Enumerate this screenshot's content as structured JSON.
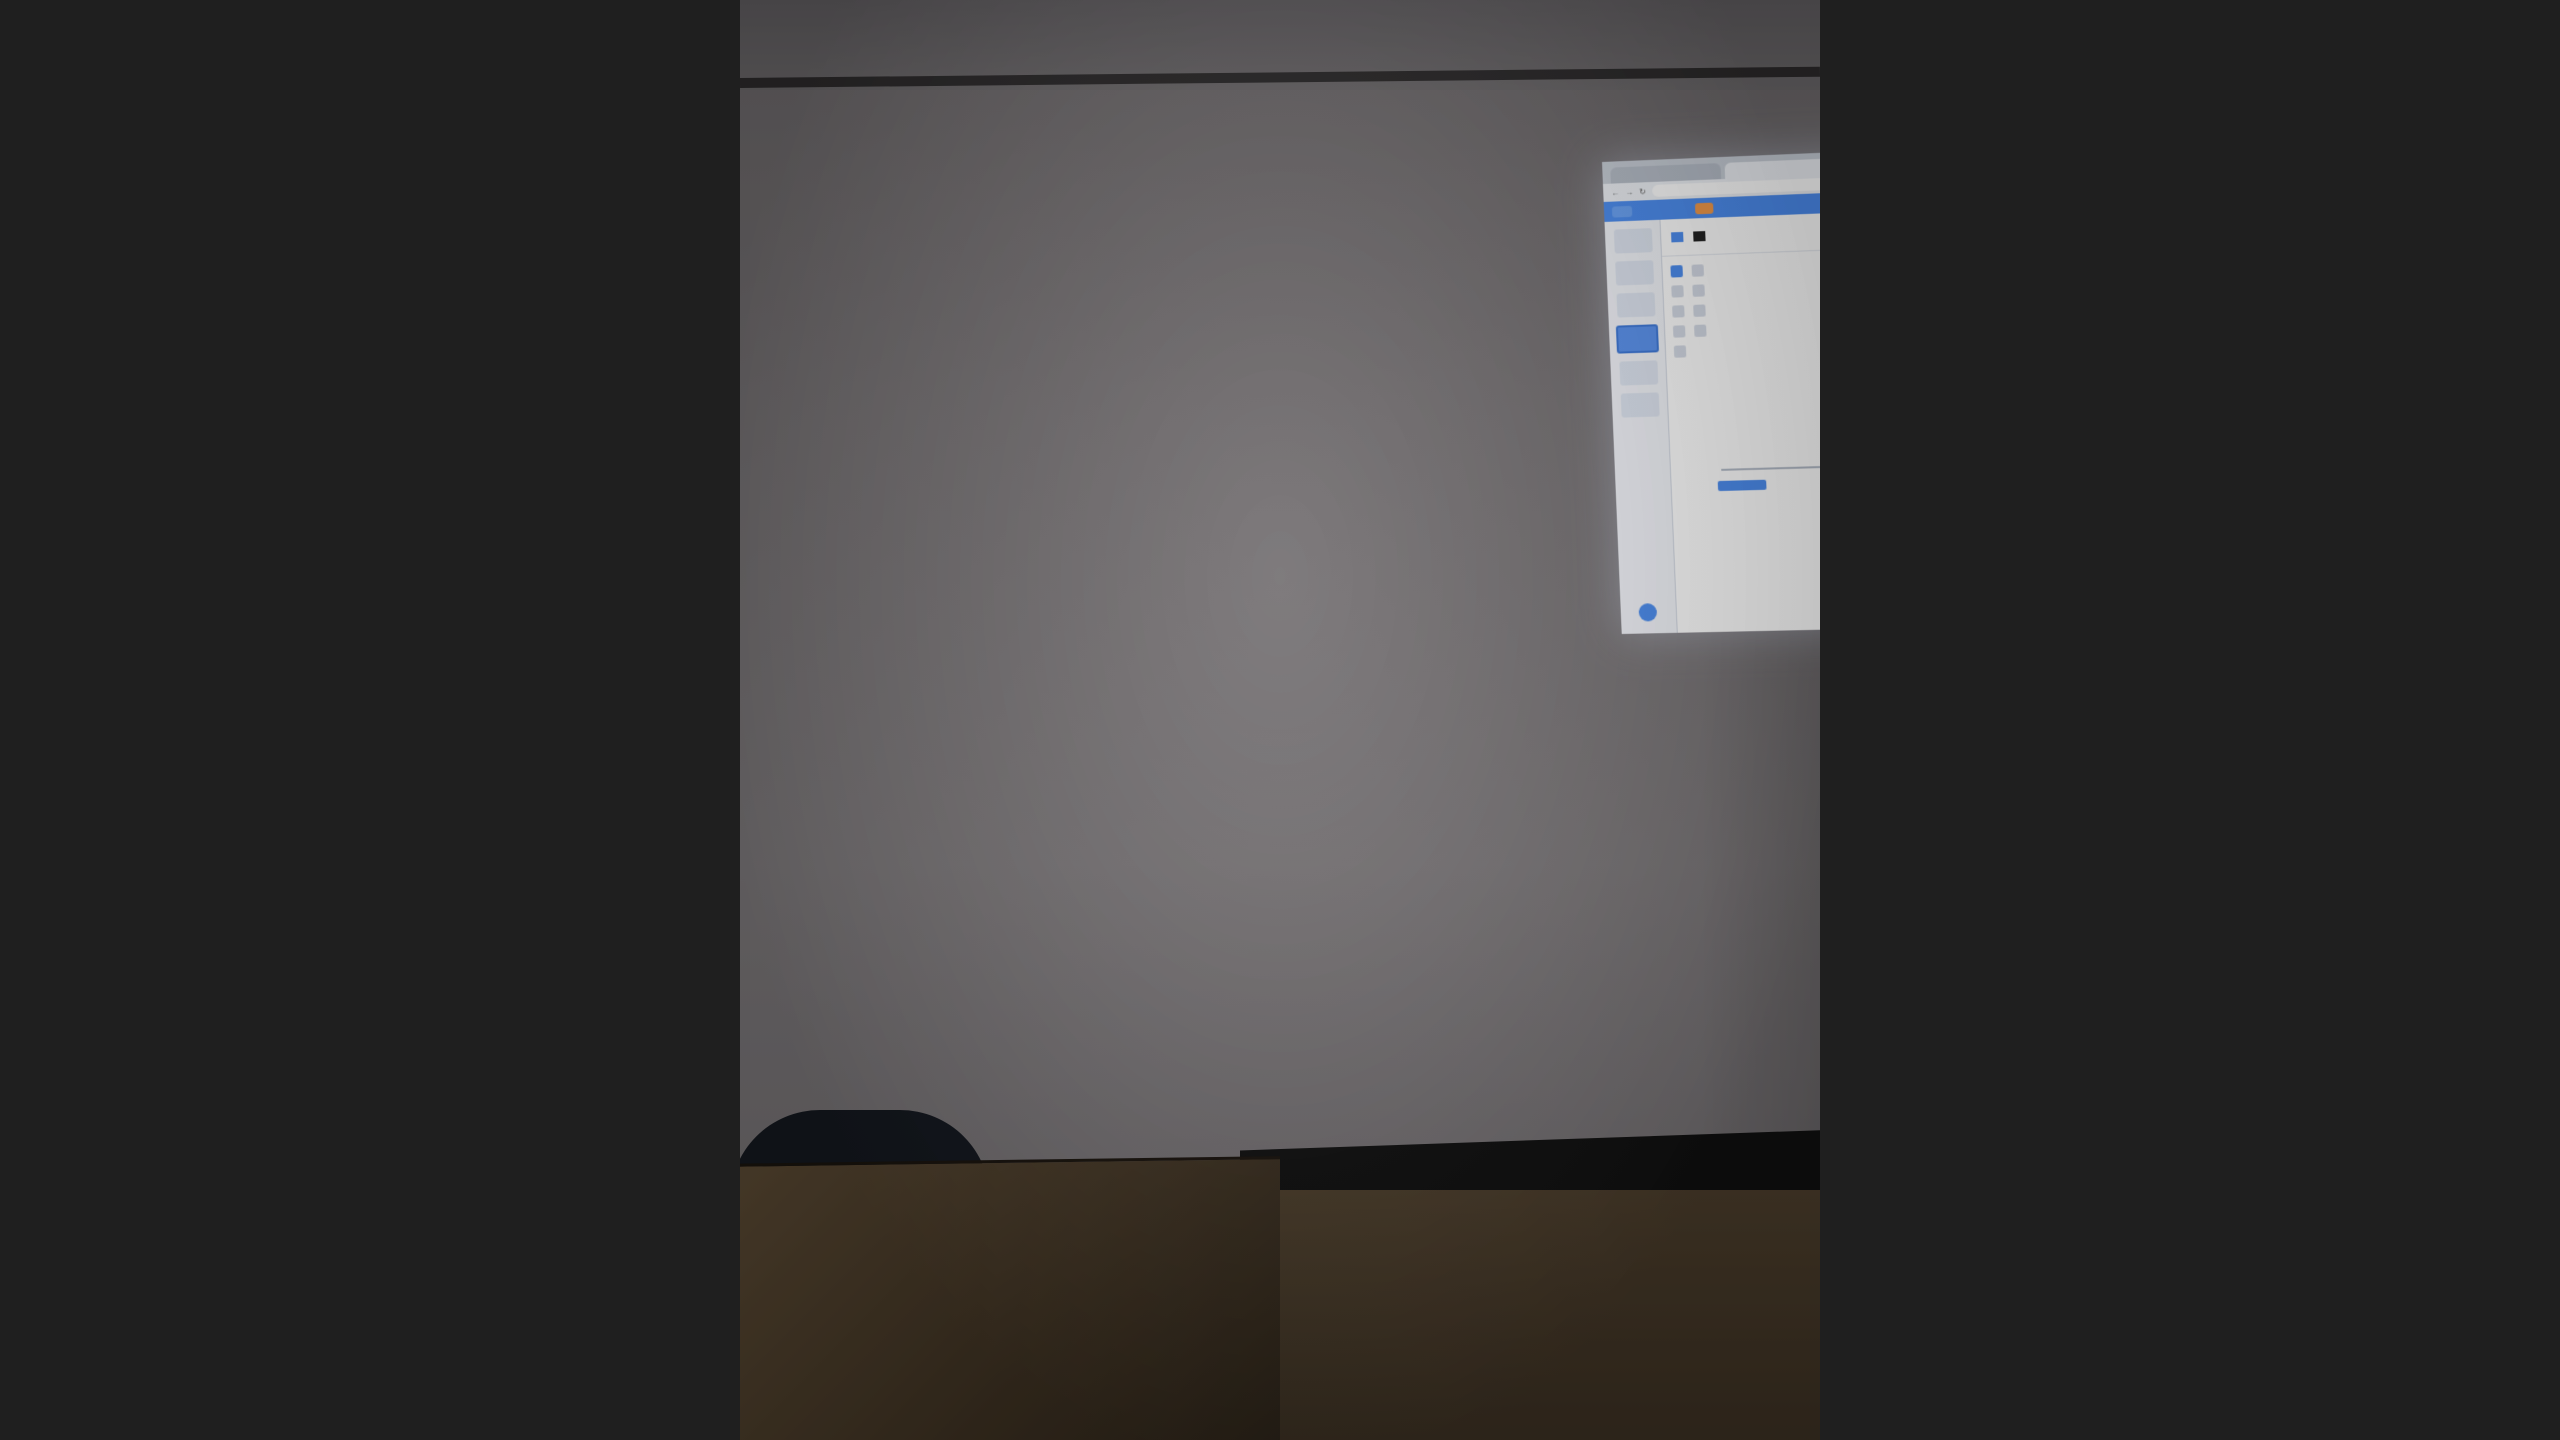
{
  "scene": {
    "description_hidden": "",
    "projected_app": {
      "tabs": [
        "",
        ""
      ],
      "url": "",
      "menu_items": [
        "",
        "",
        "",
        "",
        ""
      ],
      "convert_button_label": "",
      "colors": {
        "accent": "#4c8df0",
        "orange": "#f39a4a",
        "green_box": "#58d43c",
        "wall": "#767274",
        "background": "#1f1f1f"
      }
    }
  }
}
